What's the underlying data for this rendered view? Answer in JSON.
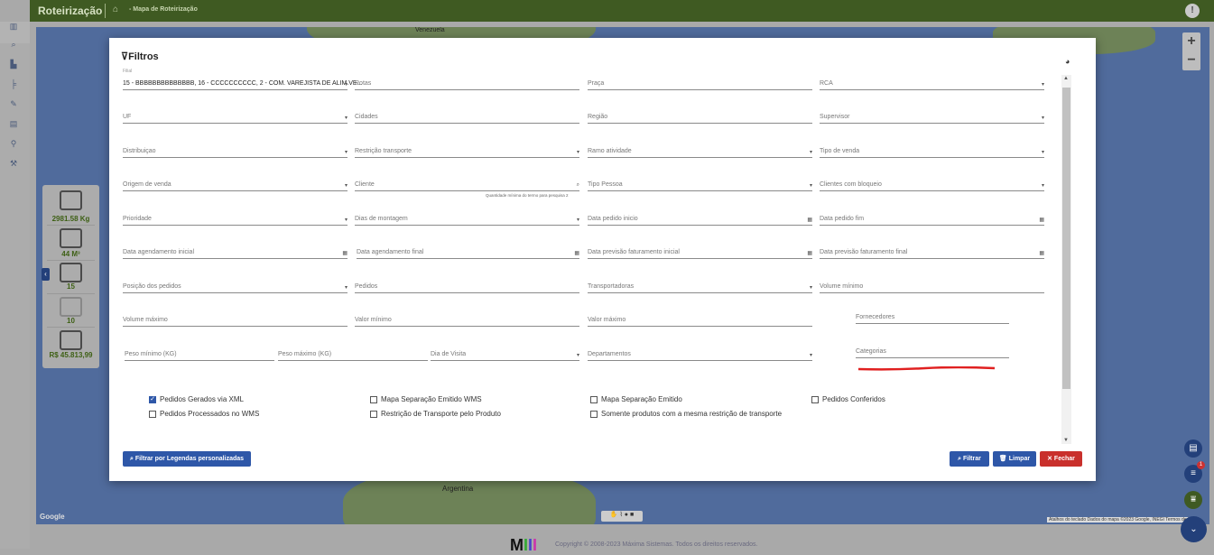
{
  "header": {
    "title": "Roteirização",
    "breadcrumb": "- Mapa de Roteirização",
    "home_icon": "home-icon",
    "info_icon": "info-icon"
  },
  "leftnav": {
    "icons": [
      "map-icon",
      "search-icon",
      "buildings-icon",
      "chart-icon",
      "edit-icon",
      "document-icon",
      "pin-icon",
      "tool-icon"
    ]
  },
  "map": {
    "zoom_in": "+",
    "zoom_out": "−",
    "google": "Google",
    "attribution": "Atalhos do teclado   Dados do mapa ©2023 Google, INEGI   Termos de Uso",
    "label_argentina": "Argentina",
    "label_venezuela": "Venezuela"
  },
  "summary": {
    "weight": "2981.58 Kg",
    "volume": "44 M³",
    "packages": "15",
    "vehicles": "10",
    "value": "R$ 45.813,99"
  },
  "modal": {
    "title": "Filtros",
    "filial_label": "Filial",
    "filial_value": "15 - BBBBBBBBBBBBBB, 16 - CCCCCCCCCC, 2 - COM. VAREJISTA DE ALIM.VE...",
    "fields": [
      "Rotas",
      "Praça",
      "RCA",
      "UF",
      "Cidades",
      "Região",
      "Supervisor",
      "Distribuiçao",
      "Restrição transporte",
      "Ramo atividade",
      "Tipo de venda",
      "Origem de venda",
      "Cliente",
      "Tipo Pessoa",
      "Clientes com bloqueio",
      "Prioridade",
      "Dias de montagem",
      "Data pedido inicio",
      "Data pedido fim",
      "Data agendamento inicial",
      "Data agendamento final",
      "Data previsão faturamento inicial",
      "Data previsão faturamento final",
      "Posição dos pedidos",
      "Pedidos",
      "Transportadoras",
      "Volume mínimo",
      "Volume máximo",
      "Valor mínimo",
      "Valor máximo",
      "Fornecedores",
      "Peso mínimo (KG)",
      "Peso máximo (KG)",
      "Dia de Visita",
      "Departamentos",
      "Categorias"
    ],
    "cliente_hint": "Quantidade mínima do termo para pesquisa 2",
    "checkboxes": [
      {
        "label": "Pedidos Gerados via XML",
        "checked": true
      },
      {
        "label": "Mapa Separação Emitido WMS",
        "checked": false
      },
      {
        "label": "Mapa Separação Emitido",
        "checked": false
      },
      {
        "label": "Pedidos Conferidos",
        "checked": false
      },
      {
        "label": "Pedidos Processados no WMS",
        "checked": false
      },
      {
        "label": "Restrição de Transporte pelo Produto",
        "checked": false
      },
      {
        "label": "Somente produtos com a mesma restrição de transporte",
        "checked": false
      }
    ],
    "buttons": {
      "legend": "⌕ Filtrar por Legendas personalizadas",
      "filter": "⌕ Filtrar",
      "clear": "🗑 Limpar",
      "close": "✕ Fechar"
    },
    "colors": {
      "primary": "#2e57a8",
      "danger": "#c9302c",
      "annotation": "#e02020"
    }
  },
  "fabs": {
    "badge": "1"
  },
  "footer": {
    "logo": "M",
    "copyright": "Copyright © 2008-2023 Máxima Sistemas. Todos os direitos reservados."
  }
}
